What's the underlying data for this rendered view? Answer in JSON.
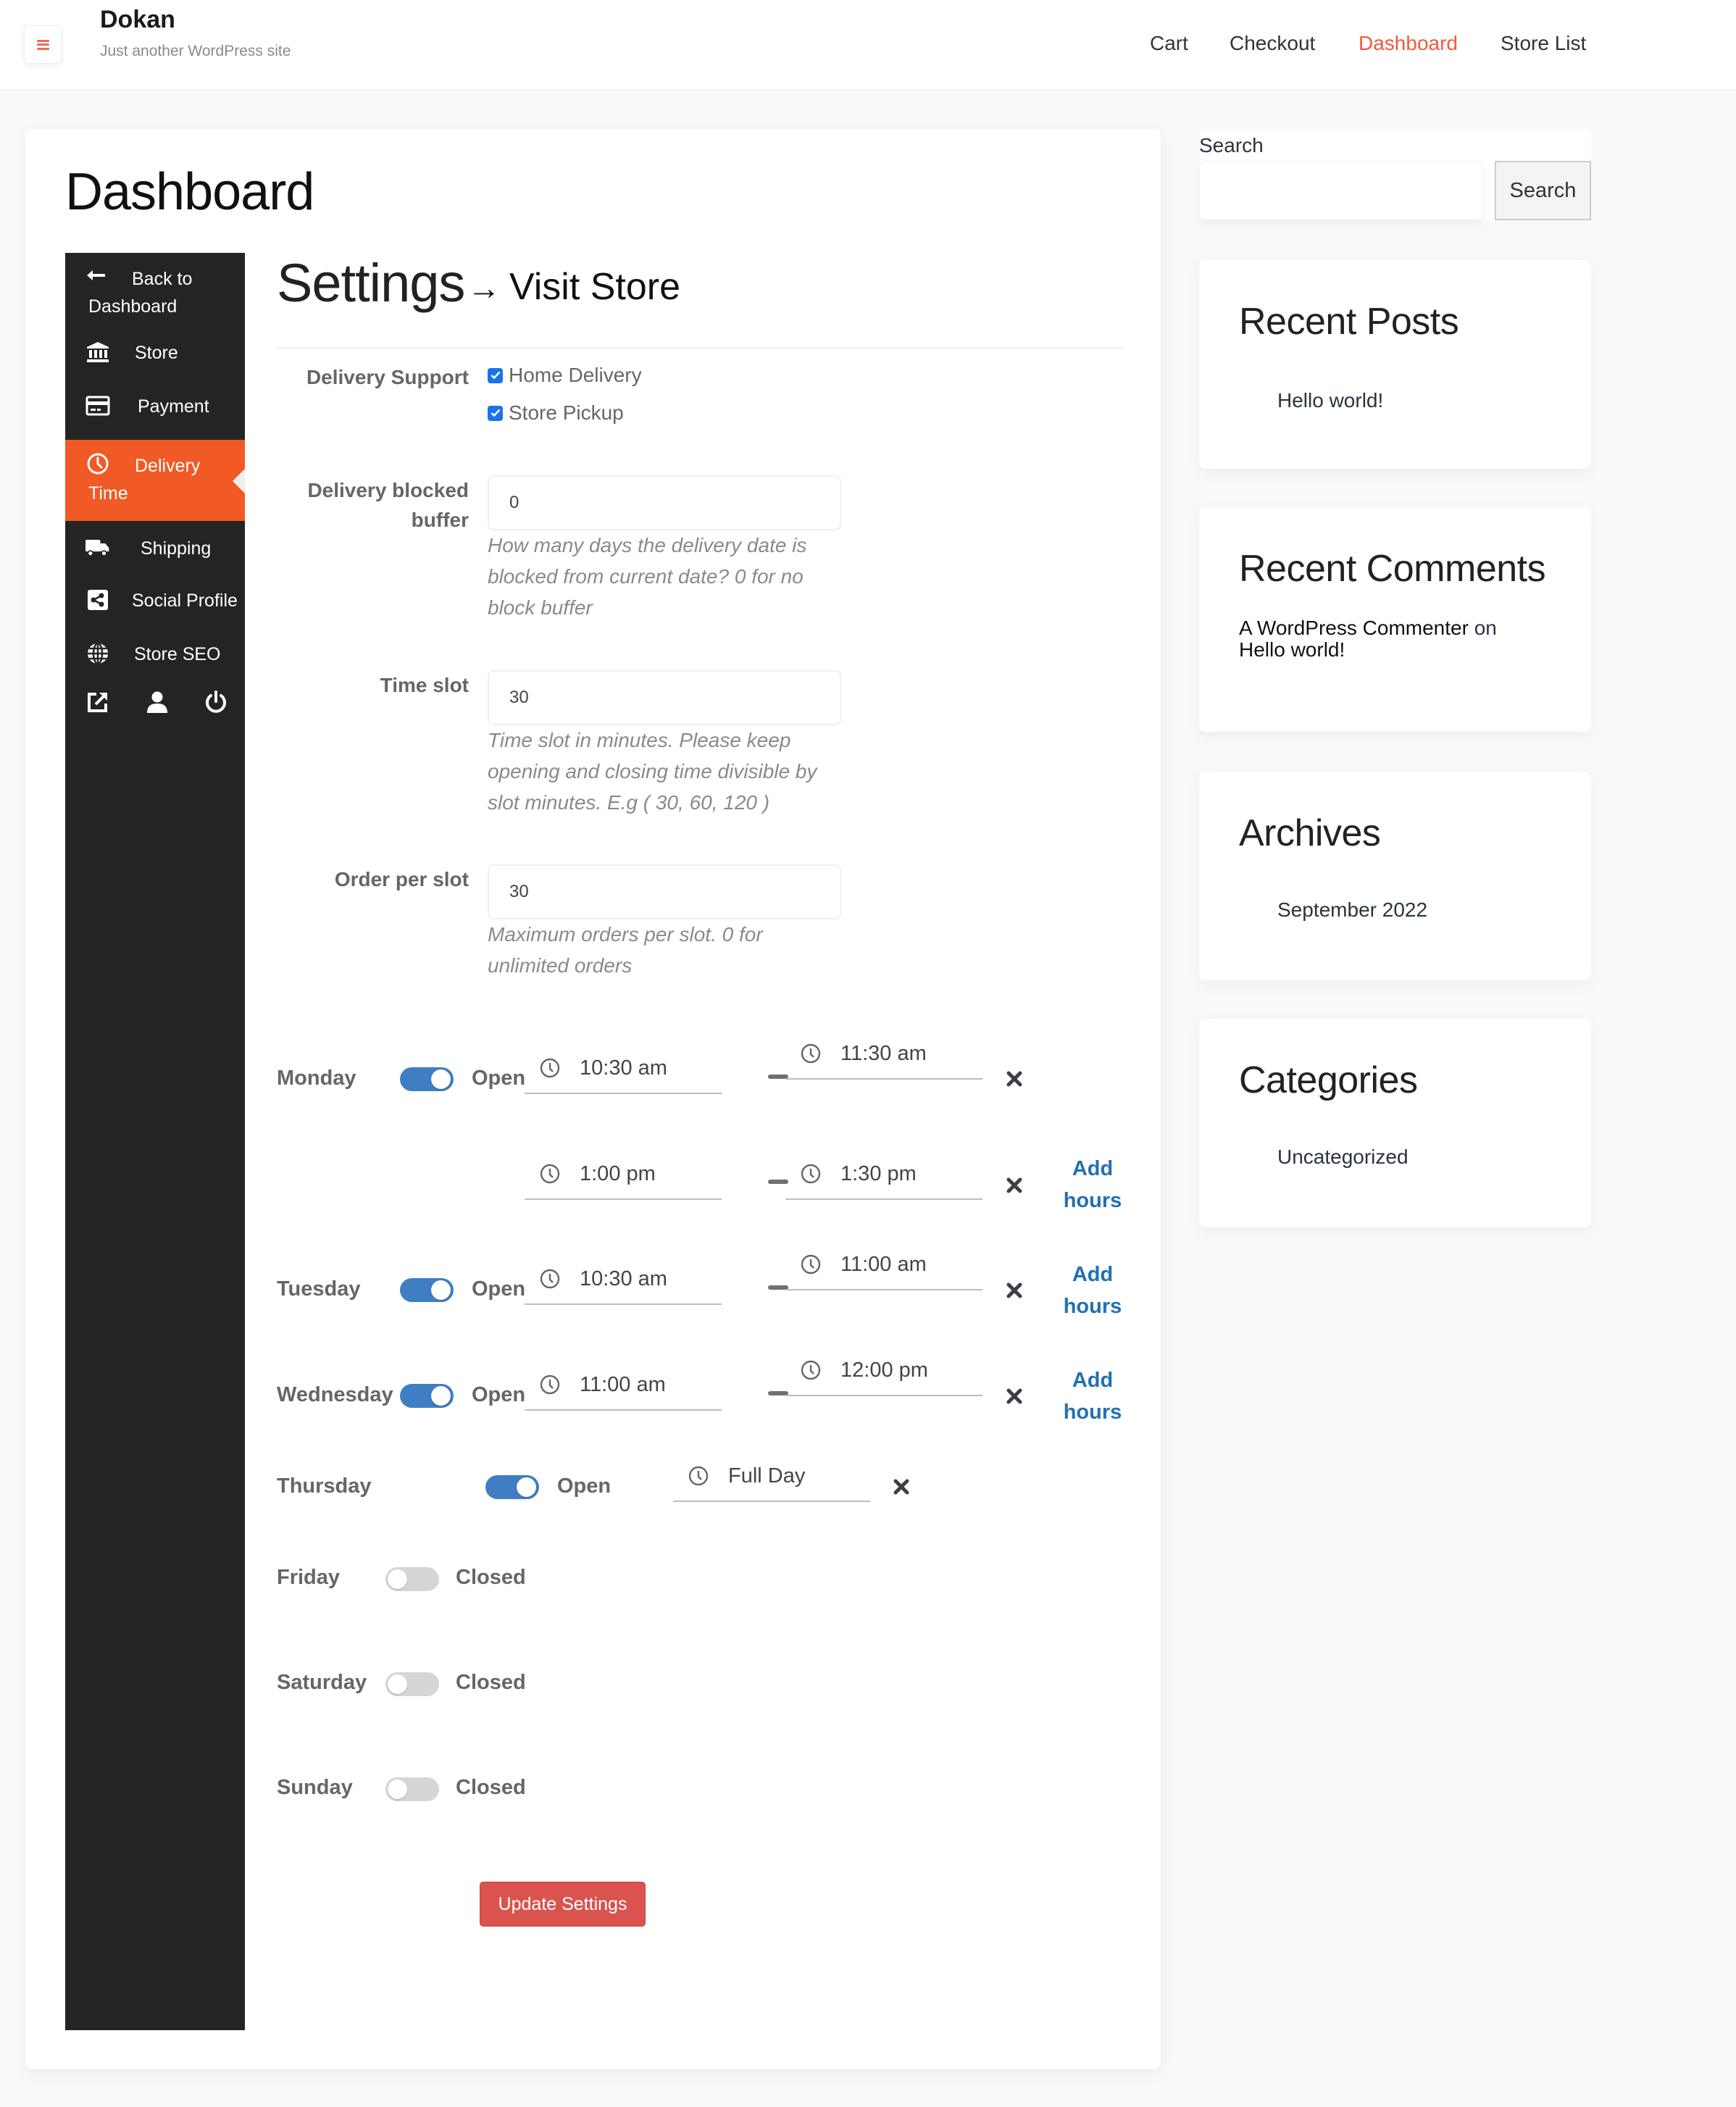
{
  "header": {
    "site_title": "Dokan",
    "site_description": "Just another WordPress site",
    "menu_icon": "hamburger-icon",
    "nav": [
      {
        "label": "Cart",
        "active": false
      },
      {
        "label": "Checkout",
        "active": false
      },
      {
        "label": "Dashboard",
        "active": true
      },
      {
        "label": "Store List",
        "active": false
      }
    ],
    "accent_color": "#f05a3c"
  },
  "page": {
    "title": "Dashboard"
  },
  "dokan_sidebar": {
    "items": [
      {
        "label": "Back to Dashboard",
        "line1": "Back to",
        "line2": "Dashboard",
        "icon": "arrow-left-icon",
        "active": false
      },
      {
        "label": "Store",
        "icon": "bank-icon",
        "active": false
      },
      {
        "label": "Payment",
        "icon": "credit-card-icon",
        "active": false
      },
      {
        "label": "Delivery Time",
        "line1": "Delivery",
        "line2": "Time",
        "icon": "clock-icon",
        "active": true
      },
      {
        "label": "Shipping",
        "icon": "truck-icon",
        "active": false
      },
      {
        "label": "Social Profile",
        "icon": "share-icon",
        "active": false
      },
      {
        "label": "Store SEO",
        "icon": "globe-icon",
        "active": false
      }
    ],
    "bottom_icons": [
      "external-link-icon",
      "user-icon",
      "power-icon"
    ],
    "active_color": "#f15a24",
    "background_color": "#242424"
  },
  "settings": {
    "title": "Settings",
    "visit_store_arrow": "→",
    "visit_store_label": "Visit Store",
    "delivery_support": {
      "label": "Delivery Support",
      "options": [
        {
          "label": "Home Delivery",
          "checked": true
        },
        {
          "label": "Store Pickup",
          "checked": true
        }
      ]
    },
    "blocked_buffer": {
      "label_line1": "Delivery blocked",
      "label_line2": "buffer",
      "value": "0",
      "help_line1": "How many days the delivery date is",
      "help_line2": "blocked from current date? 0 for no",
      "help_line3": "block buffer"
    },
    "time_slot": {
      "label": "Time slot",
      "value": "30",
      "help_line1": "Time slot in minutes. Please keep",
      "help_line2": "opening and closing time divisible by",
      "help_line3": "slot minutes. E.g ( 30, 60, 120 )"
    },
    "order_per_slot": {
      "label": "Order per slot",
      "value": "30",
      "help_line1": "Maximum orders per slot. 0 for",
      "help_line2": "unlimited orders"
    },
    "schedule": {
      "open_label": "Open",
      "closed_label": "Closed",
      "add_hours_line1": "Add",
      "add_hours_line2": "hours",
      "toggle_on_color": "#3f7ec3",
      "days": [
        {
          "day": "Monday",
          "open": true,
          "slots": [
            {
              "from": "10:30 am",
              "to": "11:30 am"
            },
            {
              "from": "1:00 pm",
              "to": "1:30 pm"
            }
          ]
        },
        {
          "day": "Tuesday",
          "open": true,
          "slots": [
            {
              "from": "10:30 am",
              "to": "11:00 am"
            }
          ]
        },
        {
          "day": "Wednesday",
          "open": true,
          "slots": [
            {
              "from": "11:00 am",
              "to": "12:00 pm"
            }
          ]
        },
        {
          "day": "Thursday",
          "open": true,
          "full_day": "Full Day"
        },
        {
          "day": "Friday",
          "open": false
        },
        {
          "day": "Saturday",
          "open": false
        },
        {
          "day": "Sunday",
          "open": false
        }
      ]
    },
    "update_button": "Update Settings",
    "update_button_color": "#d9534f"
  },
  "widgets": {
    "search": {
      "label": "Search",
      "value": "",
      "button": "Search"
    },
    "recent_posts": {
      "title": "Recent Posts",
      "items": [
        "Hello world!"
      ]
    },
    "recent_comments": {
      "title": "Recent Comments",
      "author": "A WordPress Commenter",
      "connector": "on",
      "post": "Hello world!"
    },
    "archives": {
      "title": "Archives",
      "items": [
        "September 2022"
      ]
    },
    "categories": {
      "title": "Categories",
      "items": [
        "Uncategorized"
      ]
    }
  }
}
